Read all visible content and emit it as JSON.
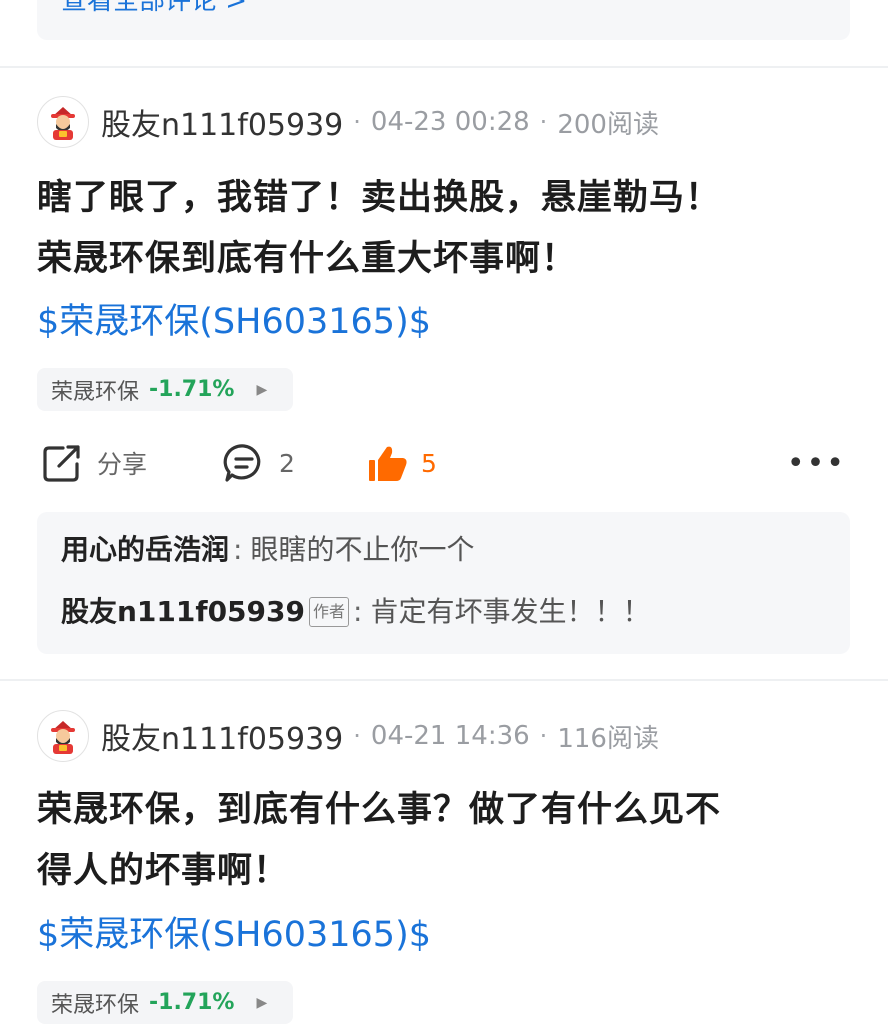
{
  "top": {
    "view_all": "查看全部评论 >"
  },
  "posts": [
    {
      "username": "股友n111f05939",
      "date": "04-23 00:28",
      "reads": "200阅读",
      "title_line1": "瞎了眼了，我错了！卖出换股，悬崖勒马！",
      "title_line2": "荣晟环保到底有什么重大坏事啊！",
      "cashtag": "$荣晟环保(SH603165)$",
      "stock": {
        "name": "荣晟环保",
        "change": "-1.71%"
      },
      "actions": {
        "share": "分享",
        "comments": "2",
        "likes": "5"
      },
      "comments": [
        {
          "author": "用心的岳浩润",
          "text": "眼瞎的不止你一个",
          "is_author": false
        },
        {
          "author": "股友n111f05939",
          "badge": "作者",
          "text": "肯定有坏事发生！！！",
          "is_author": true
        }
      ]
    },
    {
      "username": "股友n111f05939",
      "date": "04-21 14:36",
      "reads": "116阅读",
      "title_line1": "荣晟环保，到底有什么事？做了有什么见不",
      "title_line2": "得人的坏事啊！",
      "cashtag": "$荣晟环保(SH603165)$",
      "stock": {
        "name": "荣晟环保",
        "change": "-1.71%"
      }
    }
  ],
  "colors": {
    "link": "#1a73d9",
    "down": "#23a45a",
    "like": "#ff6a00"
  }
}
